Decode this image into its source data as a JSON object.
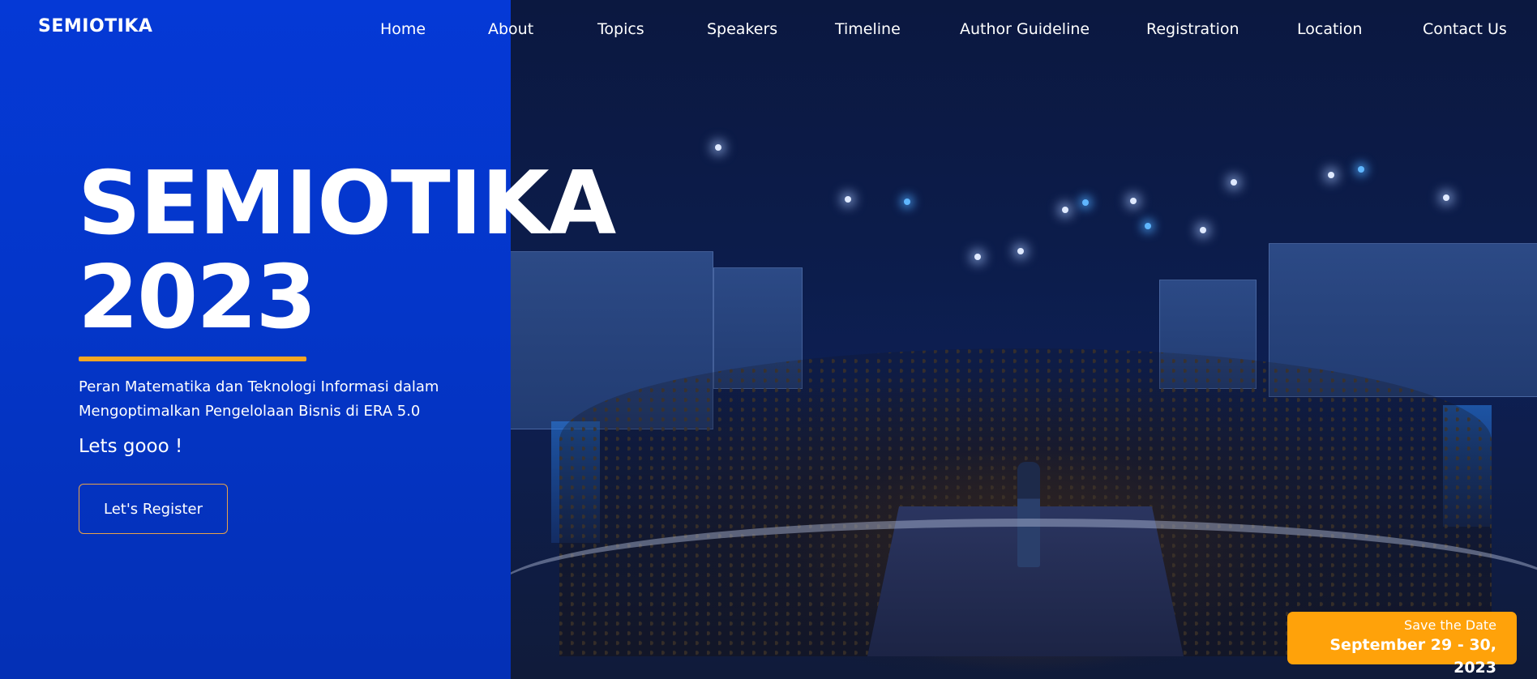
{
  "brand": {
    "logo": "SEMIOTIKA"
  },
  "nav": {
    "items": [
      {
        "label": "Home"
      },
      {
        "label": "About"
      },
      {
        "label": "Topics"
      },
      {
        "label": "Speakers"
      },
      {
        "label": "Timeline"
      },
      {
        "label": "Author Guideline"
      },
      {
        "label": "Registration"
      },
      {
        "label": "Location"
      },
      {
        "label": "Contact Us"
      }
    ]
  },
  "hero": {
    "title": "SEMIOTIKA",
    "year": "2023",
    "subtitle": "Peran Matematika dan Teknologi Informasi dalam Mengoptimalkan Pengelolaan Bisnis di ERA 5.0",
    "tagline": "Lets gooo !",
    "cta_label": "Let's Register"
  },
  "save_date": {
    "label": "Save the Date",
    "dates": "September 29 - 30, 2023"
  },
  "colors": {
    "panel_blue": "#0539d6",
    "accent_orange": "#ffa20a",
    "underline_orange": "#f5a623"
  }
}
